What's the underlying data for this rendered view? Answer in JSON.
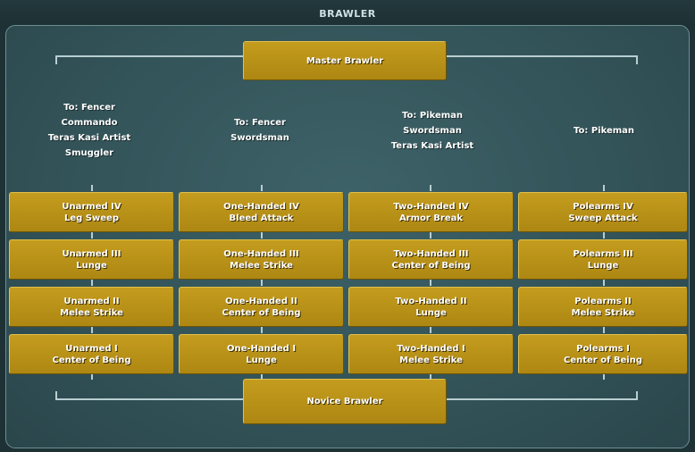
{
  "window": {
    "title": "BRAWLER"
  },
  "master": {
    "label": "Master Brawler"
  },
  "novice": {
    "label": "Novice Brawler"
  },
  "columns": [
    {
      "requirements": [
        "To: Fencer",
        "Commando",
        "Teras Kasi Artist",
        "Smuggler"
      ],
      "boxes": [
        {
          "line1": "Unarmed IV",
          "line2": "Leg Sweep"
        },
        {
          "line1": "Unarmed III",
          "line2": "Lunge"
        },
        {
          "line1": "Unarmed II",
          "line2": "Melee Strike"
        },
        {
          "line1": "Unarmed I",
          "line2": "Center of Being"
        }
      ]
    },
    {
      "requirements": [
        "To: Fencer",
        "Swordsman"
      ],
      "boxes": [
        {
          "line1": "One-Handed IV",
          "line2": "Bleed Attack"
        },
        {
          "line1": "One-Handed III",
          "line2": "Melee Strike"
        },
        {
          "line1": "One-Handed II",
          "line2": "Center of Being"
        },
        {
          "line1": "One-Handed I",
          "line2": "Lunge"
        }
      ]
    },
    {
      "requirements": [
        "To: Pikeman",
        "Swordsman",
        "Teras Kasi Artist"
      ],
      "boxes": [
        {
          "line1": "Two-Handed IV",
          "line2": "Armor Break"
        },
        {
          "line1": "Two-Handed III",
          "line2": "Center of Being"
        },
        {
          "line1": "Two-Handed II",
          "line2": "Lunge"
        },
        {
          "line1": "Two-Handed I",
          "line2": "Melee Strike"
        }
      ]
    },
    {
      "requirements": [
        "To: Pikeman"
      ],
      "boxes": [
        {
          "line1": "Polearms IV",
          "line2": "Sweep Attack"
        },
        {
          "line1": "Polearms III",
          "line2": "Lunge"
        },
        {
          "line1": "Polearms II",
          "line2": "Melee Strike"
        },
        {
          "line1": "Polearms I",
          "line2": "Center of Being"
        }
      ]
    }
  ],
  "colors": {
    "box": "#b8921a",
    "panel": "#335459",
    "line": "#b9ced1"
  }
}
